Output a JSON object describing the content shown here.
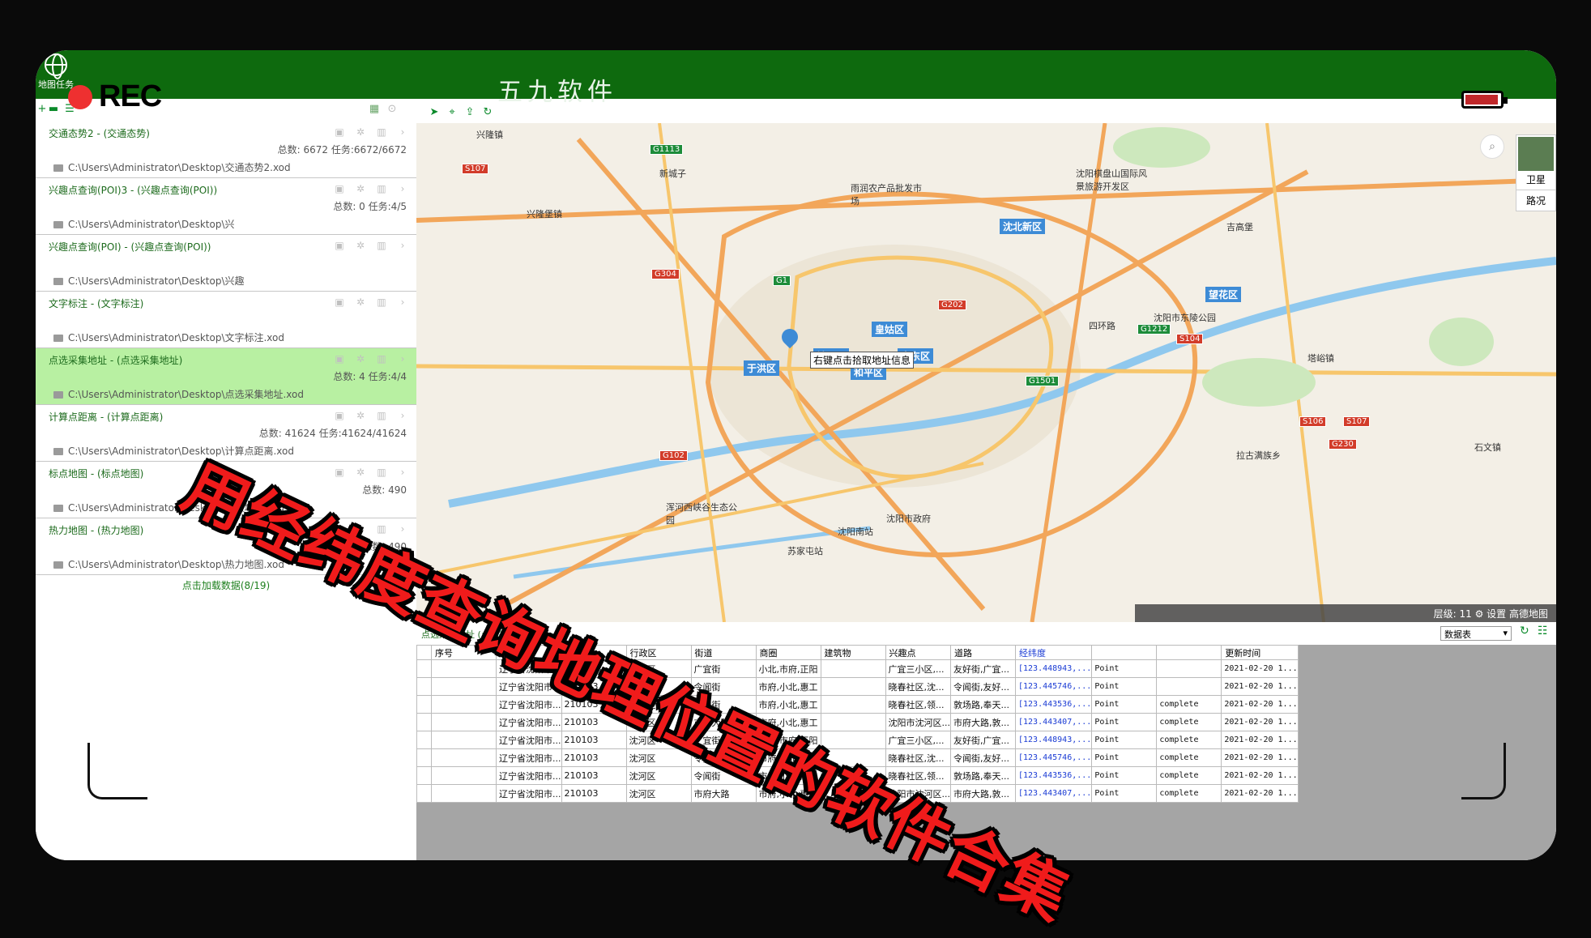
{
  "window": {
    "title": "五九软件",
    "map_task_label": "地图任务",
    "rec_label": "REC"
  },
  "tasks": [
    {
      "title": "交通态势2 - (交通态势)",
      "stats": "总数: 6672 任务:6672/6672",
      "path": "C:\\Users\\Administrator\\Desktop\\交通态势2.xod",
      "active": false
    },
    {
      "title": "兴趣点查询(POI)3 - (兴趣点查询(POI))",
      "stats": "总数: 0 任务:4/5",
      "path": "C:\\Users\\Administrator\\Desktop\\兴",
      "active": false
    },
    {
      "title": "兴趣点查询(POI) - (兴趣点查询(POI))",
      "stats": "",
      "path": "C:\\Users\\Administrator\\Desktop\\兴趣",
      "active": false
    },
    {
      "title": "文字标注 - (文字标注)",
      "stats": "",
      "path": "C:\\Users\\Administrator\\Desktop\\文字标注.xod",
      "active": false
    },
    {
      "title": "点选采集地址 - (点选采集地址)",
      "stats": "总数: 4 任务:4/4",
      "path": "C:\\Users\\Administrator\\Desktop\\点选采集地址.xod",
      "active": true
    },
    {
      "title": "计算点距离 - (计算点距离)",
      "stats": "总数: 41624 任务:41624/41624",
      "path": "C:\\Users\\Administrator\\Desktop\\计算点距离.xod",
      "active": false
    },
    {
      "title": "标点地图 - (标点地图)",
      "stats": "总数: 490",
      "path": "C:\\Users\\Administrator\\Desktop\\标点地图.xod",
      "active": false
    },
    {
      "title": "热力地图 - (热力地图)",
      "stats": "总数: 490",
      "path": "C:\\Users\\Administrator\\Desktop\\热力地图.xod",
      "active": false
    }
  ],
  "load_more": "点击加载数据(8/19)",
  "map": {
    "tooltip": "右键点击拾取地址信息",
    "satellite_label": "卫星",
    "traffic_label": "路况",
    "status": "层级:  11   ⚙ 设置 高德地图",
    "districts": [
      "沈北新区",
      "皇姑区",
      "大东区",
      "铁西区",
      "于洪区",
      "和平区",
      "望花区"
    ],
    "places": [
      "兴隆镇",
      "新城子",
      "兴隆堡镇",
      "雨润农产品批发市场",
      "沈阳棋盘山国际风景旅游开发区",
      "沈阳市东陵公园",
      "浑河西峡谷生态公园",
      "苏家屯站",
      "沈阳南站",
      "沈阳市政府",
      "四环路",
      "塔峪镇",
      "拉古满族乡",
      "吉高堡",
      "石文镇"
    ],
    "roads": [
      "G1113",
      "S107",
      "G304",
      "G1",
      "G1212",
      "G202",
      "G1501",
      "G102",
      "S106",
      "S104",
      "G230",
      "S107"
    ]
  },
  "table": {
    "title": "点选采集地址 (点选采集地址)",
    "db_select": "数据表",
    "columns": [
      "序号",
      "地址",
      "区号",
      "行政区",
      "街道",
      "商圈",
      "建筑物",
      "兴趣点",
      "道路",
      "经纬度",
      "",
      "",
      "更新时间"
    ],
    "rows": [
      [
        "",
        "辽宁省沈阳市...",
        "210103",
        "沈河区",
        "广宜街",
        "小北,市府,正阳",
        "",
        "广宜三小区,...",
        "友好街,广宜...",
        "[123.448943,...",
        "Point",
        "",
        "2021-02-20 1..."
      ],
      [
        "",
        "辽宁省沈阳市...",
        "210103",
        "沈河区",
        "令闻街",
        "市府,小北,惠工",
        "",
        "晓春社区,沈...",
        "令闻街,友好...",
        "[123.445746,...",
        "Point",
        "",
        "2021-02-20 1..."
      ],
      [
        "",
        "辽宁省沈阳市...",
        "210103",
        "沈河区",
        "令闻街",
        "市府,小北,惠工",
        "",
        "晓春社区,领...",
        "敦场路,奉天...",
        "[123.443536,...",
        "Point",
        "complete",
        "2021-02-20 1..."
      ],
      [
        "",
        "辽宁省沈阳市...",
        "210103",
        "沈河区",
        "市府大路",
        "市府,小北,惠工",
        "",
        "沈阳市沈河区...",
        "市府大路,敦...",
        "[123.443407,...",
        "Point",
        "complete",
        "2021-02-20 1..."
      ],
      [
        "",
        "辽宁省沈阳市...",
        "210103",
        "沈河区",
        "广宜街",
        "小北,市府,正阳",
        "",
        "广宜三小区,...",
        "友好街,广宜...",
        "[123.448943,...",
        "Point",
        "complete",
        "2021-02-20 1..."
      ],
      [
        "",
        "辽宁省沈阳市...",
        "210103",
        "沈河区",
        "令闻街",
        "市府,小北,惠工",
        "",
        "晓春社区,沈...",
        "令闻街,友好...",
        "[123.445746,...",
        "Point",
        "complete",
        "2021-02-20 1..."
      ],
      [
        "",
        "辽宁省沈阳市...",
        "210103",
        "沈河区",
        "令闻街",
        "市府,小北,惠工",
        "",
        "晓春社区,领...",
        "敦场路,奉天...",
        "[123.443536,...",
        "Point",
        "complete",
        "2021-02-20 1..."
      ],
      [
        "",
        "辽宁省沈阳市...",
        "210103",
        "沈河区",
        "市府大路",
        "市府,小北,惠工",
        "",
        "沈阳市沈河区...",
        "市府大路,敦...",
        "[123.443407,...",
        "Point",
        "complete",
        "2021-02-20 1..."
      ]
    ]
  },
  "overlay_title": "用经纬度查询地理位置的软件合集",
  "colors": {
    "titlebar": "#0e6a0e",
    "active_task": "#b8f0a2",
    "overlay_text": "#f01b1b"
  }
}
